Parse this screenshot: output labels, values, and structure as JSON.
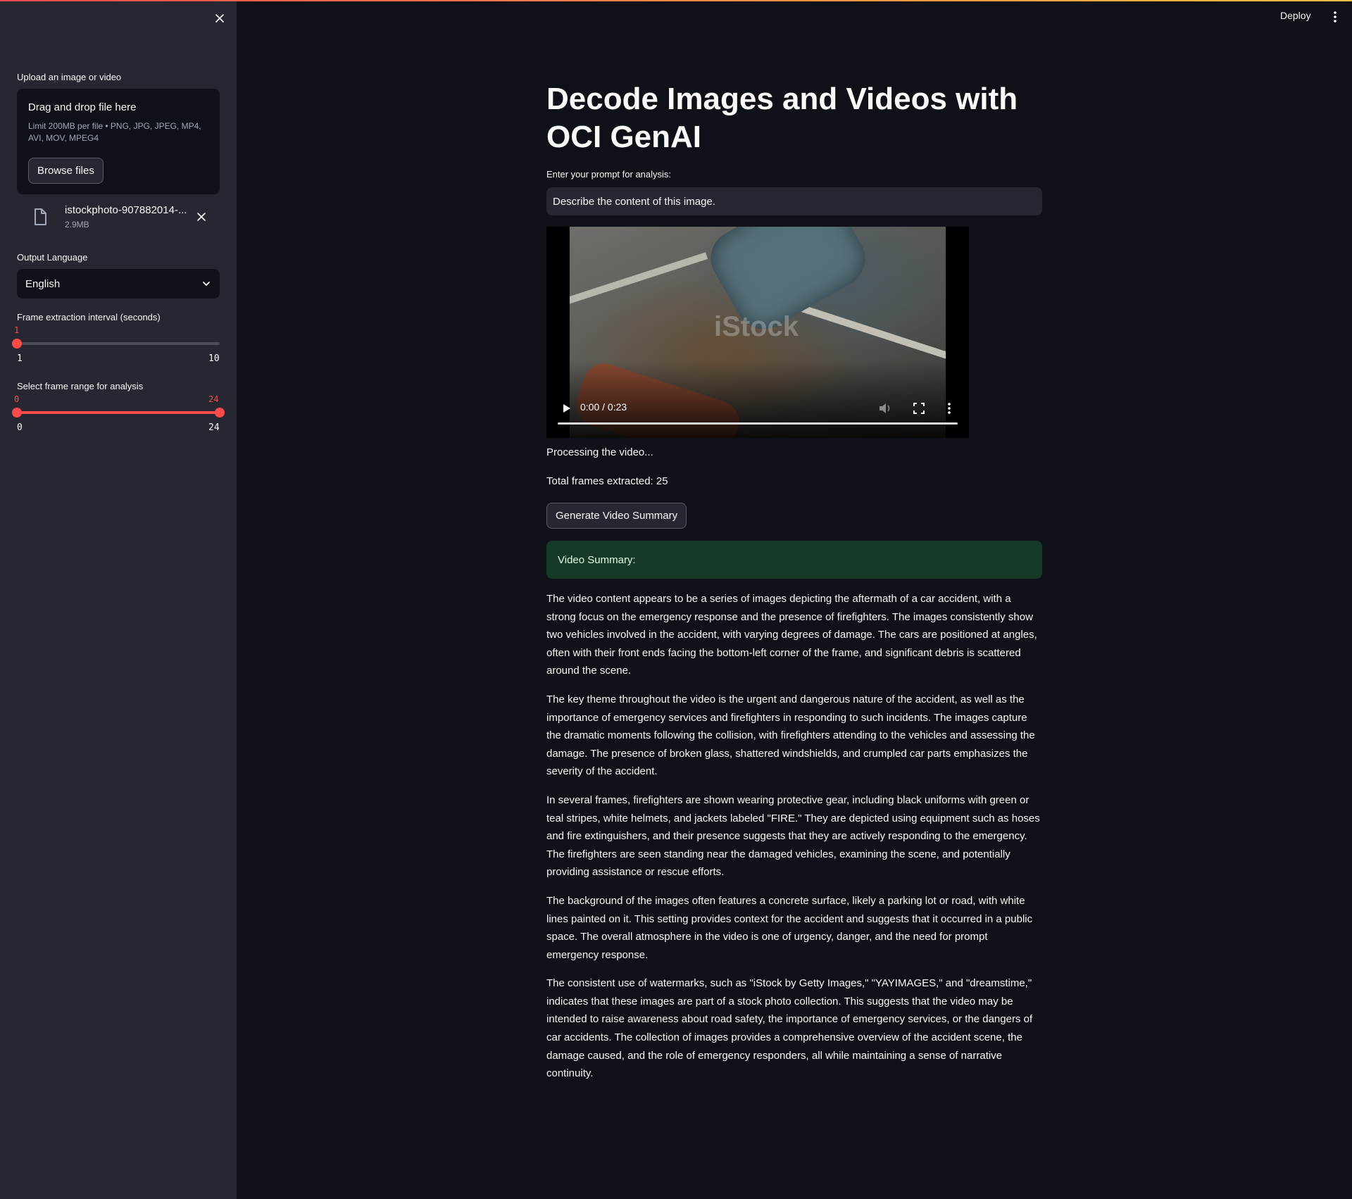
{
  "sidebar": {
    "uploader_label": "Upload an image or video",
    "dropzone_title": "Drag and drop file here",
    "dropzone_limit": "Limit 200MB per file • PNG, JPG, JPEG, MP4, AVI, MOV, MPEG4",
    "browse_label": "Browse files",
    "file": {
      "name": "istockphoto-907882014-...",
      "size": "2.9MB"
    },
    "language_label": "Output Language",
    "language_value": "English",
    "interval_slider": {
      "label": "Frame extraction interval (seconds)",
      "value": "1",
      "min": "1",
      "max": "10",
      "fraction": 0.0
    },
    "range_slider": {
      "label": "Select frame range for analysis",
      "low": "0",
      "high": "24",
      "min": "0",
      "max": "24",
      "low_fraction": 0.0,
      "high_fraction": 1.0
    }
  },
  "header": {
    "deploy_label": "Deploy"
  },
  "main": {
    "title": "Decode Images and Videos with OCI GenAI",
    "prompt_label": "Enter your prompt for analysis:",
    "prompt_value": "Describe the content of this image.",
    "video": {
      "time": "0:00 / 0:23",
      "progress_fraction": 0.0,
      "watermark": "iStock"
    },
    "processing_text": "Processing the video...",
    "frames_text": "Total frames extracted: 25",
    "generate_label": "Generate Video Summary",
    "summary_header": "Video Summary:",
    "summary_paragraphs": [
      "The video content appears to be a series of images depicting the aftermath of a car accident, with a strong focus on the emergency response and the presence of firefighters. The images consistently show two vehicles involved in the accident, with varying degrees of damage. The cars are positioned at angles, often with their front ends facing the bottom-left corner of the frame, and significant debris is scattered around the scene.",
      "The key theme throughout the video is the urgent and dangerous nature of the accident, as well as the importance of emergency services and firefighters in responding to such incidents. The images capture the dramatic moments following the collision, with firefighters attending to the vehicles and assessing the damage. The presence of broken glass, shattered windshields, and crumpled car parts emphasizes the severity of the accident.",
      "In several frames, firefighters are shown wearing protective gear, including black uniforms with green or teal stripes, white helmets, and jackets labeled \"FIRE.\" They are depicted using equipment such as hoses and fire extinguishers, and their presence suggests that they are actively responding to the emergency. The firefighters are seen standing near the damaged vehicles, examining the scene, and potentially providing assistance or rescue efforts.",
      "The background of the images often features a concrete surface, likely a parking lot or road, with white lines painted on it. This setting provides context for the accident and suggests that it occurred in a public space. The overall atmosphere in the video is one of urgency, danger, and the need for prompt emergency response.",
      "The consistent use of watermarks, such as \"iStock by Getty Images,\" \"YAYIMAGES,\" and \"dreamstime,\" indicates that these images are part of a stock photo collection. This suggests that the video may be intended to raise awareness about road safety, the importance of emergency services, or the dangers of car accidents. The collection of images provides a comprehensive overview of the accident scene, the damage caused, and the role of emergency responders, all while maintaining a sense of narrative continuity."
    ]
  },
  "colors": {
    "accent": "#ff4b4b",
    "background": "#0e1117",
    "sidebar": "#262730",
    "success_bg": "#173928"
  },
  "icons": [
    "close-icon",
    "file-icon",
    "chevron-down-icon",
    "play-icon",
    "volume-icon",
    "fullscreen-icon",
    "more-vert-icon"
  ]
}
